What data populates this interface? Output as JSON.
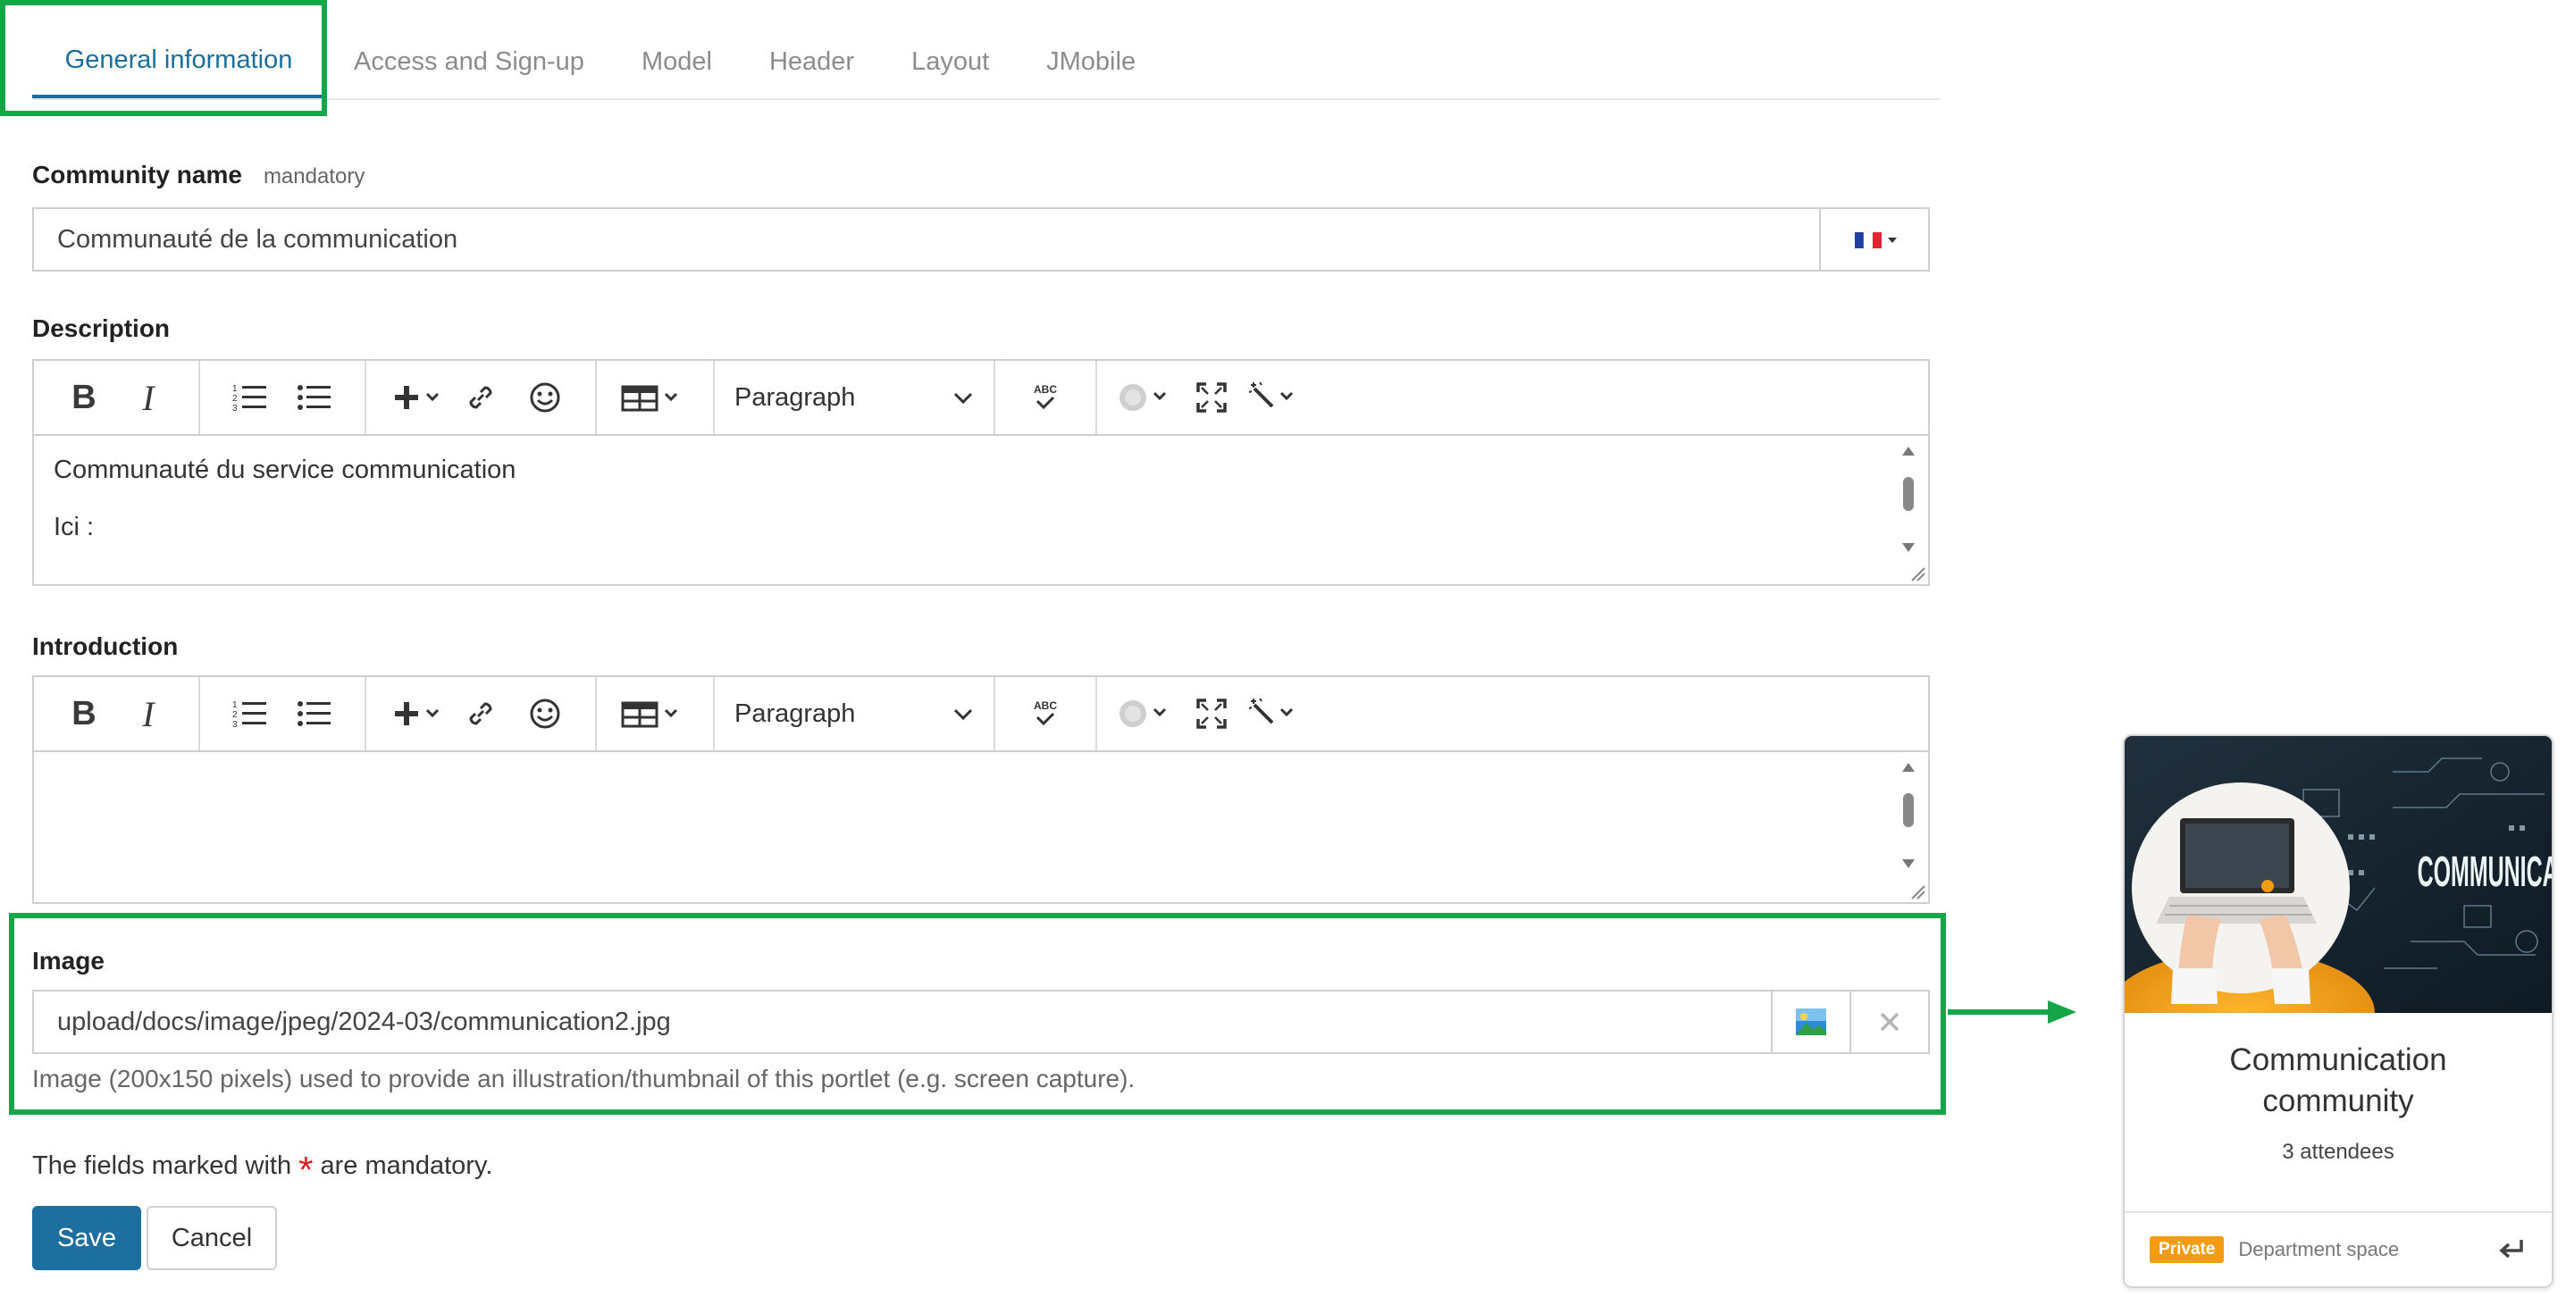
{
  "tabs": [
    {
      "label": "General information",
      "active": true
    },
    {
      "label": "Access and Sign-up"
    },
    {
      "label": "Model"
    },
    {
      "label": "Header"
    },
    {
      "label": "Layout"
    },
    {
      "label": "JMobile"
    }
  ],
  "community_name": {
    "label": "Community name",
    "mandatory_label": "mandatory",
    "value": "Communauté de la communication",
    "language_icon": "french-flag-icon"
  },
  "description": {
    "label": "Description",
    "paragraph_label": "Paragraph",
    "lines": [
      "Communauté du service communication",
      "Ici :"
    ]
  },
  "introduction": {
    "label": "Introduction",
    "paragraph_label": "Paragraph"
  },
  "toolbar_icons": [
    "bold-icon",
    "italic-icon",
    "ordered-list-icon",
    "bullet-list-icon",
    "insert-plus-icon",
    "link-icon",
    "emoji-icon",
    "table-icon",
    "spellcheck-icon",
    "translate-icon",
    "fullscreen-icon",
    "magic-wand-icon"
  ],
  "toolbar_letters": {
    "bold": "B",
    "italic": "I",
    "spell": "ABC"
  },
  "image": {
    "label": "Image",
    "value": "upload/docs/image/jpeg/2024-03/communication2.jpg",
    "help": "Image (200x150 pixels) used to provide an illustration/thumbnail of this portlet (e.g. screen capture)."
  },
  "mandatory_note": {
    "before": "The fields marked with",
    "star": "*",
    "after": "are mandatory."
  },
  "buttons": {
    "save": "Save",
    "cancel": "Cancel"
  },
  "card": {
    "image_text": "COMMUNICATION",
    "title_line1": "Communication",
    "title_line2": "community",
    "attendees": "3 attendees",
    "badge": "Private",
    "space": "Department space"
  },
  "colors": {
    "accent": "#1b6e9c",
    "highlight": "#17a54a",
    "save_button": "#1d6fa0",
    "badge": "#f39c12",
    "required_star": "#e02020"
  }
}
